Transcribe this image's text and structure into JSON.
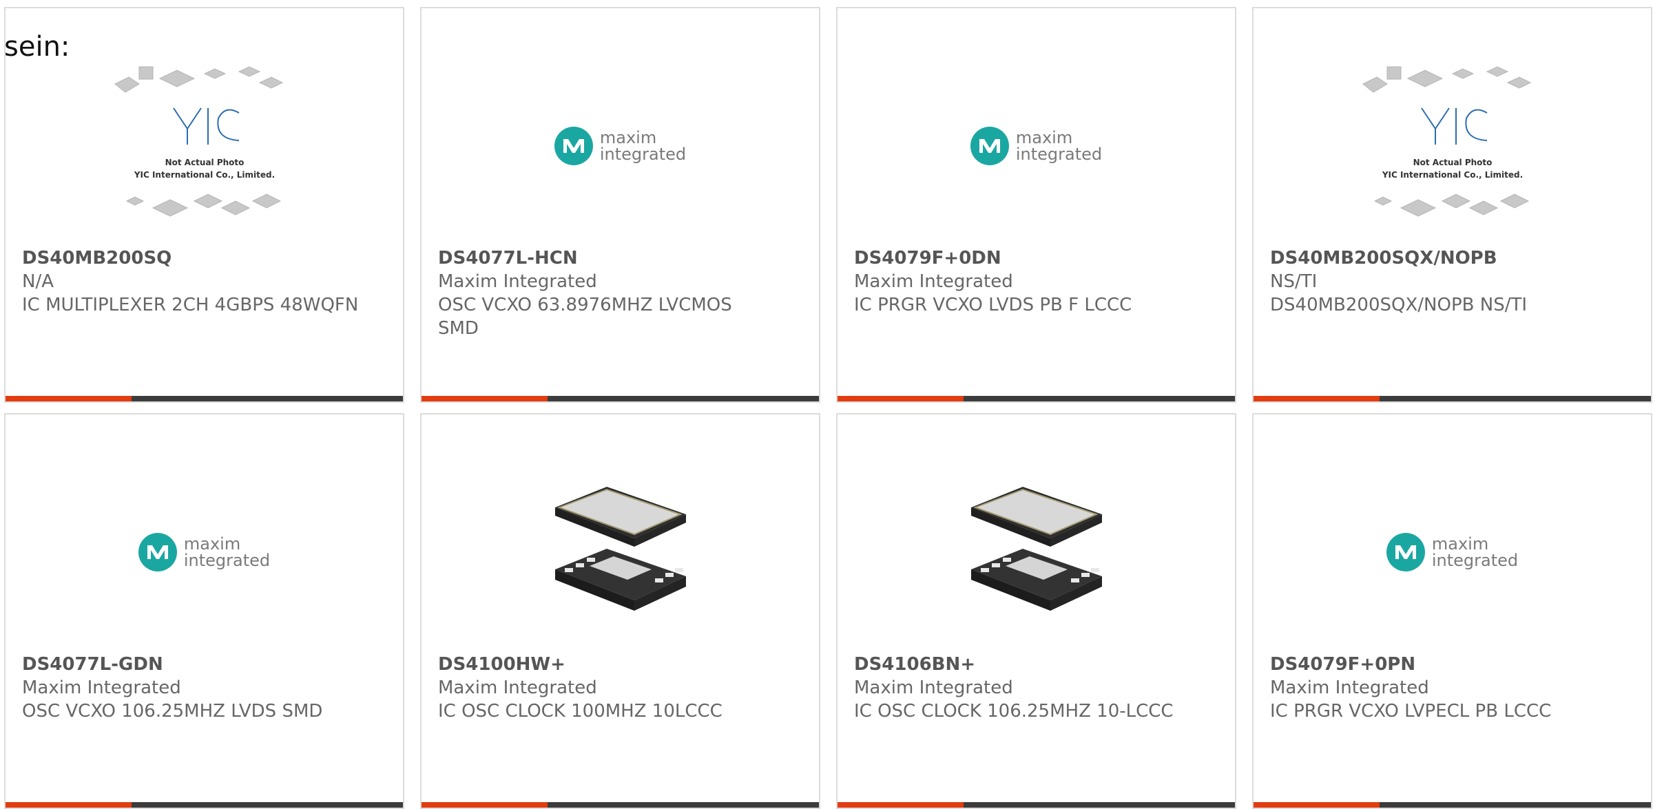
{
  "intro": {
    "text": "sein:"
  },
  "logos": {
    "yic": {
      "brand": "YIC",
      "line1": "Not Actual Photo",
      "line2": "YIC International Co., Limited."
    },
    "maxim": {
      "word1": "maxim",
      "word2": "integrated",
      "tm": "™",
      "color": "#1aa7a1"
    }
  },
  "colors": {
    "accent": "#e23c10",
    "bar": "#3c3c3c",
    "border": "#dcdcdc"
  },
  "products": [
    {
      "part": "DS40MB200SQ",
      "manufacturer": "N/A",
      "description": "IC MULTIPLEXER 2CH 4GBPS 48WQFN",
      "image": "yic-placeholder"
    },
    {
      "part": "DS4077L-HCN",
      "manufacturer": "Maxim Integrated",
      "description": "OSC VCXO 63.8976MHZ LVCMOS SMD",
      "image": "maxim-logo"
    },
    {
      "part": "DS4079F+0DN",
      "manufacturer": "Maxim Integrated",
      "description": "IC PRGR VCXO LVDS PB F LCCC",
      "image": "maxim-logo"
    },
    {
      "part": "DS40MB200SQX/NOPB",
      "manufacturer": "NS/TI",
      "description": "DS40MB200SQX/NOPB NS/TI",
      "image": "yic-placeholder"
    },
    {
      "part": "DS4077L-GDN",
      "manufacturer": "Maxim Integrated",
      "description": "OSC VCXO 106.25MHZ LVDS SMD",
      "image": "maxim-logo"
    },
    {
      "part": "DS4100HW+",
      "manufacturer": "Maxim Integrated",
      "description": "IC OSC CLOCK 100MHZ 10LCCC",
      "image": "chip-photo"
    },
    {
      "part": "DS4106BN+",
      "manufacturer": "Maxim Integrated",
      "description": "IC OSC CLOCK 106.25MHZ 10-LCCC",
      "image": "chip-photo"
    },
    {
      "part": "DS4079F+0PN",
      "manufacturer": "Maxim Integrated",
      "description": "IC PRGR VCXO LVPECL PB LCCC",
      "image": "maxim-logo"
    }
  ]
}
